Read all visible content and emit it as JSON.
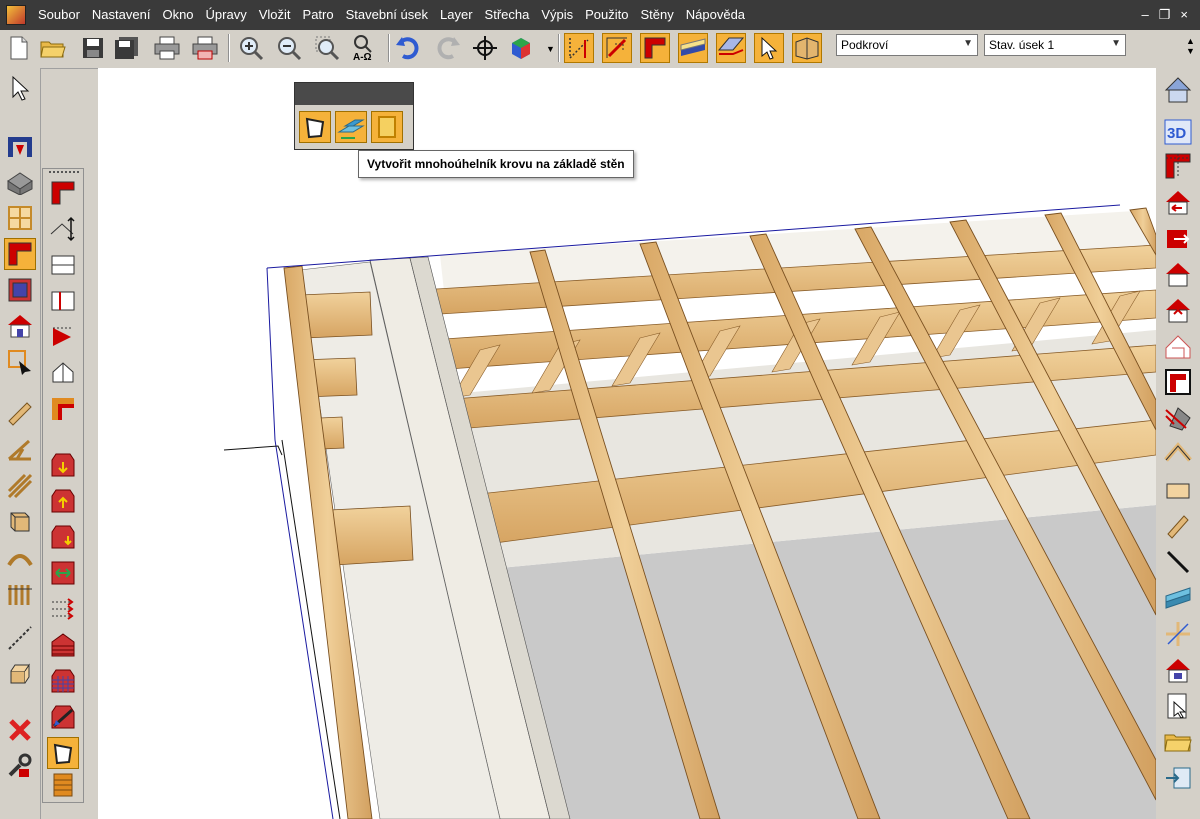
{
  "menubar": {
    "items": [
      "Soubor",
      "Nastavení",
      "Okno",
      "Úpravy",
      "Vložit",
      "Patro",
      "Stavební úsek",
      "Layer",
      "Střecha",
      "Výpis",
      "Použito",
      "Stěny",
      "Nápověda"
    ],
    "window_minimize": "–",
    "window_restore": "❐",
    "window_close": "×"
  },
  "toolbar": {
    "floor_combo": "Podkroví",
    "section_combo": "Stav. úsek 1",
    "text_tool_label": "A-Ω",
    "right_3d_label": "3D"
  },
  "tooltip": {
    "text": "Vytvořit mnohoúhelník krovu na základě stěn"
  },
  "colors": {
    "highlight": "#f5b23a",
    "menubar_bg": "#3a3a3a",
    "wood": "#e2b878",
    "insulation": "#e8e6e0",
    "roof_grey": "#c9c9c9",
    "outline_blue": "#1a1aa0"
  },
  "icons": {
    "toolbar": [
      "new-file-icon",
      "open-folder-icon",
      "save-icon",
      "save-all-icon",
      "print-icon",
      "print-preview-icon",
      "zoom-in-icon",
      "zoom-out-icon",
      "zoom-window-icon",
      "text-symbol-icon",
      "undo-icon",
      "redo-icon",
      "crosshair-icon",
      "3d-cube-icon",
      "dimension-tool-icon",
      "roof-red-icon",
      "roof-section-icon",
      "roof-layer-icon",
      "roof-plan-icon",
      "cursor-icon",
      "book-icon"
    ],
    "left": [
      "pointer-icon",
      "stair-icon",
      "roof-box-icon",
      "window-grid-icon",
      "roof-corner-icon",
      "frame-icon",
      "house-icon",
      "select-edit-icon",
      "beam-icon",
      "truss-icon",
      "diagonal-icon",
      "stack-icon",
      "arch-icon",
      "pillar-icon",
      "line-icon",
      "box-3d-icon",
      "delete-icon",
      "properties-icon"
    ],
    "right": [
      "house-view-icon",
      "3d-view-icon",
      "section-icon",
      "house-left-icon",
      "house-right-icon",
      "house-red-icon",
      "house-dormer-icon",
      "roof-outline-icon",
      "roof-red-icon",
      "chimney-icon",
      "gable-icon",
      "slab-icon",
      "beam-diag-icon",
      "line-diag-icon",
      "rafter-icon",
      "axis-icon",
      "house-window-icon",
      "view-icon",
      "folder-open-icon",
      "settings-icon"
    ]
  }
}
